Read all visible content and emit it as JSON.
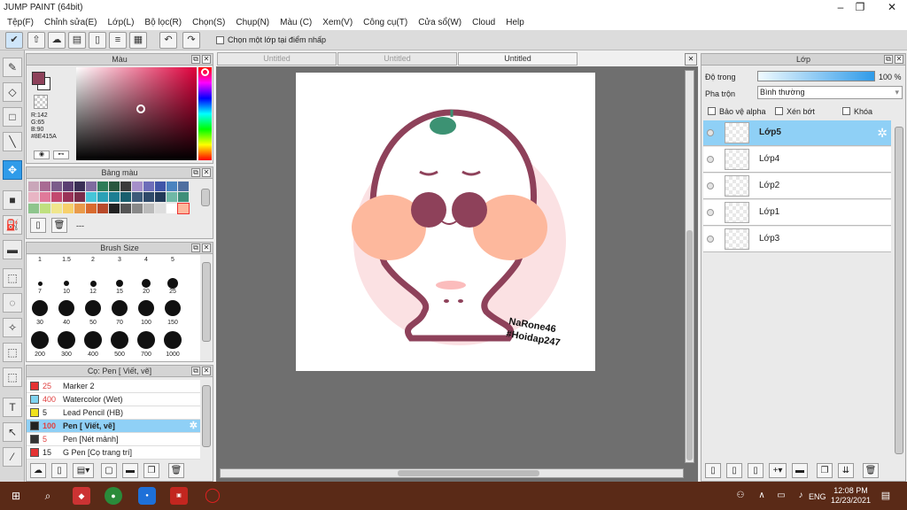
{
  "window": {
    "title": "JUMP PAINT (64bit)"
  },
  "menu": [
    "Tệp(F)",
    "Chỉnh sửa(E)",
    "Lớp(L)",
    "Bộ lọc(R)",
    "Chọn(S)",
    "Chụp(N)",
    "Màu (C)",
    "Xem(V)",
    "Công cụ(T)",
    "Cửa sổ(W)",
    "Cloud",
    "Help"
  ],
  "toolbar": {
    "select_layer_label": "Chọn một lớp tại điểm nhấp"
  },
  "color_panel": {
    "title": "Màu",
    "r": "R:142",
    "g": "G:65",
    "b": "B:90",
    "hex": "#8E415A",
    "main_color": "#8e415a"
  },
  "palette_panel": {
    "title": "Bảng màu",
    "name": "---"
  },
  "brush_size_panel": {
    "title": "Brush Size",
    "row1": [
      "1",
      "1.5",
      "2",
      "3",
      "4",
      "5"
    ],
    "row2": [
      "7",
      "10",
      "12",
      "15",
      "20",
      "25"
    ],
    "row3": [
      "30",
      "40",
      "50",
      "70",
      "100",
      "150"
    ],
    "row4": [
      "200",
      "300",
      "400",
      "500",
      "700",
      "1000"
    ]
  },
  "brush_list_panel": {
    "title": "Cọ: Pen [ Viết, vẽ]",
    "items": [
      {
        "size": "25",
        "name": "Marker 2",
        "color": "#e53333"
      },
      {
        "size": "400",
        "name": "Watercolor (Wet)",
        "color": "#7fd3f0"
      },
      {
        "size": "5",
        "name": "Lead Pencil (HB)",
        "color": "#f1e21e"
      },
      {
        "size": "100",
        "name": "Pen [ Viết, vẽ]",
        "color": "#222222"
      },
      {
        "size": "5",
        "name": "Pen [Nét mảnh]",
        "color": "#333333"
      },
      {
        "size": "15",
        "name": "G Pen [Cọ trang trí]",
        "color": "#e53333"
      }
    ]
  },
  "documents": {
    "tabs": [
      "Untitled",
      "Untitled",
      "Untitled"
    ]
  },
  "artwork": {
    "signature_line1": "NaRone46",
    "signature_line2": "#Hoidap247"
  },
  "layers_panel": {
    "title": "Lớp",
    "opacity_label": "Độ trong",
    "opacity_value": "100 %",
    "opacity": 1.0,
    "blend_label": "Pha trộn",
    "blend_value": "Bình thường",
    "protect_alpha": "Bảo vệ alpha",
    "clipping": "Xén bớt",
    "lock": "Khóa",
    "layers": [
      "Lớp5",
      "Lớp4",
      "Lớp2",
      "Lớp1",
      "Lớp3"
    ]
  },
  "taskbar": {
    "time": "12:08 PM",
    "date": "12/23/2021",
    "lang": "ENG"
  }
}
